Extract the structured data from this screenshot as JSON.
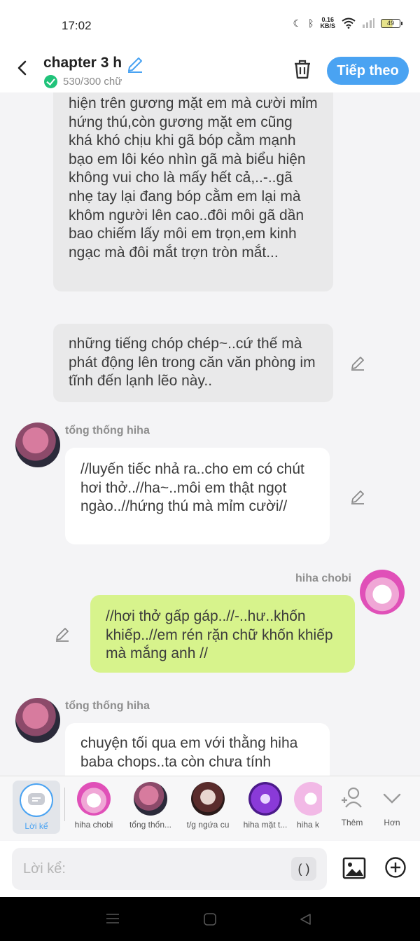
{
  "status": {
    "time": "17:02",
    "net_speed_top": "0.16",
    "net_speed_bottom": "KB/S",
    "battery": "49"
  },
  "header": {
    "title": "chapter 3 h",
    "word_count": "530/300 chữ",
    "next_label": "Tiếp theo"
  },
  "messages": {
    "narr1": "hiện trên gương mặt em mà cười mỉm hứng thú,còn gương mặt em cũng khá khó chịu khi gã bóp cằm mạnh bạo em lôi kéo nhìn gã mà biểu hiện không vui cho là mấy hết cả,..-..gã nhẹ tay lại đang bóp cằm em lại mà khôm người lên cao..đôi môi gã dần bao chiếm lấy môi em trọn,em kinh ngạc mà đôi mắt trợn tròn mắt...",
    "narr2": "những tiếng chóp chép~..cứ thế mà phát động lên trong căn văn phòng im tĩnh đến lạnh lẽo này..",
    "m3_name": "tổng thống hiha",
    "m3_text": "//luyến tiếc nhả ra..cho em có chút hơi thở..//ha~..môi em thật ngọt ngào..//hứng thú mà mỉm cười//",
    "m4_name": "hiha chobi",
    "m4_text": "//hơi thở gấp gáp..//-..hư..khốn khiếp..//em rén rặn chữ khốn khiếp mà mắng anh //",
    "m5_name": "tổng thống hiha",
    "m5_text": "chuyện tối qua em với thằng hiha baba chops..ta còn chưa tính"
  },
  "characters": {
    "narrator": "Lời kể",
    "c1": "hiha chobi",
    "c2": "tổng thốn...",
    "c3": "t/g ngứa cu",
    "c4": "hiha mặt t...",
    "c5": "hiha k",
    "add": "Thêm",
    "more": "Hơn"
  },
  "input": {
    "placeholder": "Lời kể:",
    "paren": "( )"
  },
  "colors": {
    "accent": "#4aa3f2",
    "green_bubble": "#d7f38c",
    "narration_bg": "#e9e9ea",
    "check": "#20c37a"
  }
}
